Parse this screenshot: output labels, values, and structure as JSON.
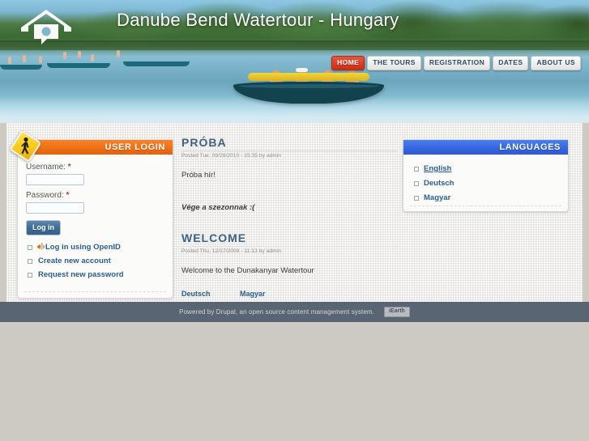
{
  "site": {
    "title": "Danube Bend Watertour - Hungary",
    "logo_icon": "house-speech-bubble-logo"
  },
  "nav": {
    "items": [
      {
        "label": "HOME",
        "active": true
      },
      {
        "label": "THE TOURS",
        "active": false
      },
      {
        "label": "REGISTRATION",
        "active": false
      },
      {
        "label": "DATES",
        "active": false
      },
      {
        "label": "ABOUT US",
        "active": false
      }
    ]
  },
  "sidebar_left": {
    "login_block": {
      "title": "USER LOGIN",
      "badge_icon": "pedestrian-crossing-icon",
      "username_label": "Username:",
      "username_required": "*",
      "username_value": "",
      "username_placeholder": "",
      "password_label": "Password:",
      "password_required": "*",
      "password_value": "",
      "password_placeholder": "",
      "submit_label": "Log in",
      "links": [
        {
          "label": "Log in using OpenID",
          "icon": "openid-icon"
        },
        {
          "label": "Create new account",
          "icon": ""
        },
        {
          "label": "Request new password",
          "icon": ""
        }
      ]
    }
  },
  "sidebar_right": {
    "languages_block": {
      "title": "LANGUAGES",
      "items": [
        {
          "label": "English",
          "current": true
        },
        {
          "label": "Deutsch",
          "current": false
        },
        {
          "label": "Magyar",
          "current": false
        }
      ]
    }
  },
  "main": {
    "nodes": [
      {
        "title": "PRÓBA",
        "submitted": "Posted Tue, 09/28/2010 - 15:35 by admin",
        "body": "Próba hír!",
        "body2": "Vége a szezonnak :(",
        "links": []
      },
      {
        "title": "WELCOME",
        "submitted": "Posted Thu, 12/17/2009 - 11:13 by admin",
        "body": "Welcome to the Dunakanyar Watertour",
        "body2": "",
        "links": [
          {
            "label": "Deutsch"
          },
          {
            "label": "Magyar"
          }
        ]
      }
    ]
  },
  "footer": {
    "text": "Powered by Drupal, an open source content management system.",
    "badge": "iEarth"
  },
  "colors": {
    "nav_active": "#de3f25",
    "login_header": "#f06f14",
    "languages_header": "#3567e0",
    "node_title": "#3d6284",
    "link": "#2b5e93",
    "footer_bg": "#596573",
    "page_bg": "#cdc9c3"
  }
}
